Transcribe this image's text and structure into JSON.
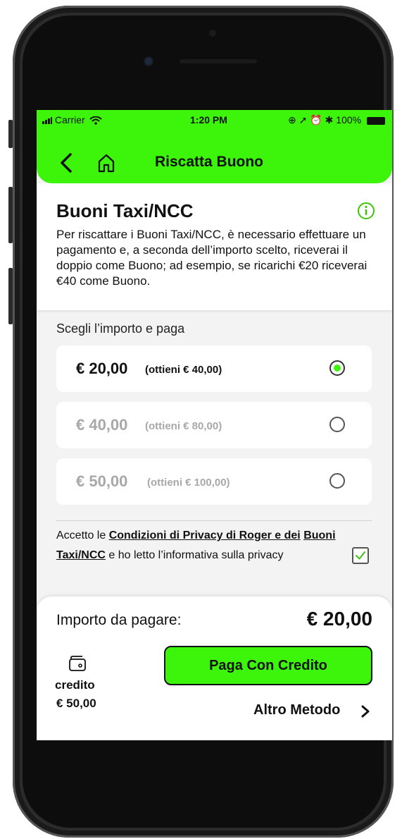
{
  "status_bar": {
    "carrier": "Carrier",
    "time": "1:20 PM",
    "battery": "100%"
  },
  "header": {
    "title": "Riscatta Buono"
  },
  "intro": {
    "heading": "Buoni Taxi/NCC",
    "description": "Per riscattare i Buoni Taxi/NCC, è necessario effettuare un pagamento e, a seconda dell’importo scelto, riceverai il doppio come Buono; ad esempio, se ricarichi €20 riceverai €40 come Buono."
  },
  "amount_section": {
    "label": "Scegli l’importo e paga",
    "options": [
      {
        "amount": "€ 20,00",
        "gets": "(ottieni € 40,00)",
        "selected": true
      },
      {
        "amount": "€ 40,00",
        "gets": "(ottieni € 80,00)",
        "selected": false
      },
      {
        "amount": "€ 50,00",
        "gets": "(ottieni € 100,00)",
        "selected": false
      }
    ]
  },
  "terms": {
    "prefix": "Accetto le ",
    "link1": "Condizioni di Privacy di Roger e dei",
    "link2": "Buoni Taxi/NCC",
    "suffix": " e ho letto l’informativa sulla privacy",
    "checked": true
  },
  "payment": {
    "label": "Importo da pagare:",
    "value": "€ 20,00",
    "credit_label": "credito",
    "credit_value": "€ 50,00",
    "pay_button": "Paga Con Credito",
    "other_method": "Altro Metodo"
  },
  "colors": {
    "accent": "#3cf50a"
  }
}
